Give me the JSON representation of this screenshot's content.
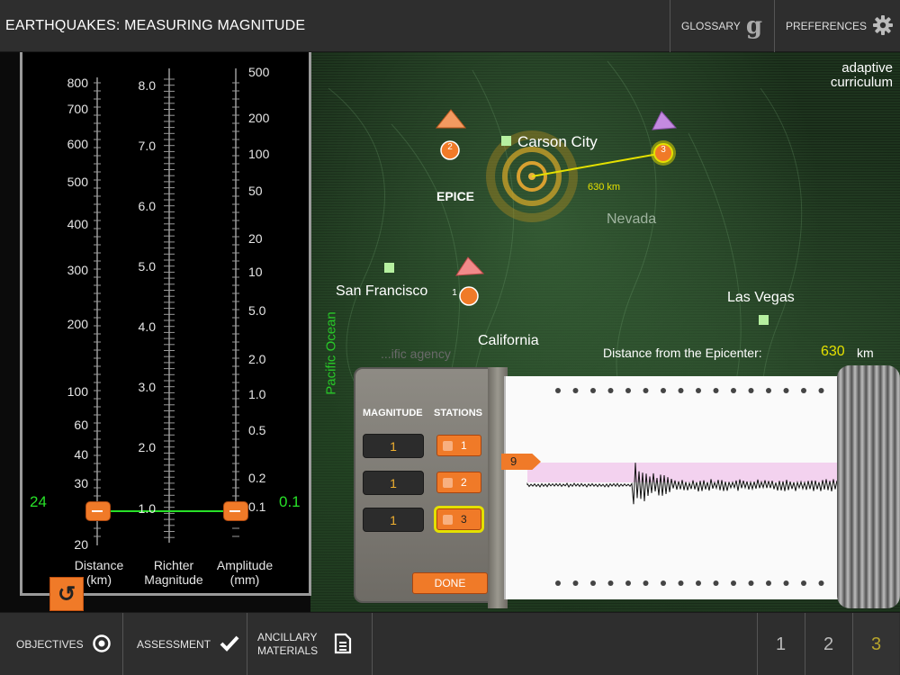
{
  "header": {
    "title": "EARTHQUAKES: MEASURING MAGNITUDE",
    "glossary_label": "GLOSSARY",
    "preferences_label": "PREFERENCES"
  },
  "logo": {
    "line1": "adaptive",
    "line2": "curriculum"
  },
  "meter": {
    "distance_ticks": [
      "800",
      "700",
      "600",
      "500",
      "400",
      "300",
      "200",
      "100",
      "60",
      "40",
      "30",
      "20"
    ],
    "magnitude_ticks": [
      "8.0",
      "7.0",
      "6.0",
      "5.0",
      "4.0",
      "3.0",
      "2.0",
      "1.0"
    ],
    "amplitude_ticks": [
      "500",
      "200",
      "100",
      "50",
      "20",
      "10",
      "5.0",
      "2.0",
      "1.0",
      "0.5",
      "0.2",
      "0.1"
    ],
    "distance_title_1": "Distance",
    "distance_title_2": "(km)",
    "magnitude_title_1": "Richter",
    "magnitude_title_2": "Magnitude",
    "amplitude_title_1": "Amplitude",
    "amplitude_title_2": "(mm)",
    "distance_value": "24",
    "amplitude_value": "0.1",
    "line_color": "#28e028"
  },
  "map": {
    "places": {
      "carson_city": "Carson City",
      "nevada": "Nevada",
      "san_francisco": "San Francisco",
      "las_vegas": "Las Vegas",
      "california": "California",
      "pacific_ocean": "Pacific Ocean",
      "epicenter_partial": "EPICE",
      "faded_label": "...ific agency"
    },
    "distance_line_label": "630 km",
    "stations": [
      "1",
      "2",
      "3"
    ],
    "distance_label": "Distance from the Epicenter:",
    "distance_value": "630",
    "distance_unit": "km"
  },
  "controls": {
    "magnitude_header": "MAGNITUDE",
    "stations_header": "STATIONS",
    "rows": [
      {
        "magnitude": "1",
        "station": "1"
      },
      {
        "magnitude": "1",
        "station": "2"
      },
      {
        "magnitude": "1",
        "station": "3"
      }
    ],
    "done_label": "DONE"
  },
  "seismograph": {
    "marker_value": "9"
  },
  "bottom": {
    "objectives_label": "OBJECTIVES",
    "assessment_label": "ASSESSMENT",
    "ancillary_line1": "ANCILLARY",
    "ancillary_line2": "MATERIALS",
    "pages": [
      "1",
      "2",
      "3"
    ]
  },
  "colors": {
    "accent": "#f07a28",
    "highlight": "#e4e000",
    "active_page": "#b6a32c"
  }
}
